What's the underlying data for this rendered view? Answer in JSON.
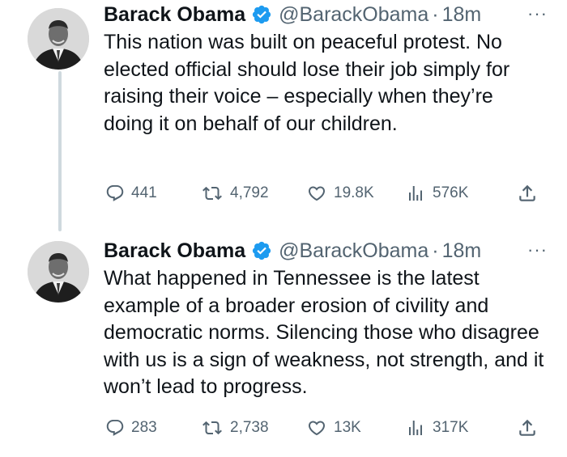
{
  "tweets": [
    {
      "author": "Barack Obama",
      "handle": "@BarackObama",
      "separator": "·",
      "time": "18m",
      "more": "···",
      "text": "This nation was built on peaceful protest. No elected official should lose their job simply for raising their voice – especially when they’re doing it on behalf of our children.",
      "replies": "441",
      "reposts": "4,792",
      "likes": "19.8K",
      "views": "576K"
    },
    {
      "author": "Barack Obama",
      "handle": "@BarackObama",
      "separator": "·",
      "time": "18m",
      "more": "···",
      "text": "What happened in Tennessee is the latest example of a broader erosion of civility and democratic norms. Silencing those who disagree with us is a sign of weakness, not strength, and it won’t lead to progress.",
      "replies": "283",
      "reposts": "2,738",
      "likes": "13K",
      "views": "317K"
    }
  ],
  "icons": {
    "verified": "verified-badge-icon",
    "reply": "reply-bubble-icon",
    "repost": "repost-arrows-icon",
    "like": "heart-icon",
    "views": "bar-chart-icon",
    "share": "share-upload-icon"
  },
  "colors": {
    "verified": "#1d9bf0",
    "text": "#0f1419",
    "muted": "#536471",
    "thread_line": "#cfd9de"
  }
}
